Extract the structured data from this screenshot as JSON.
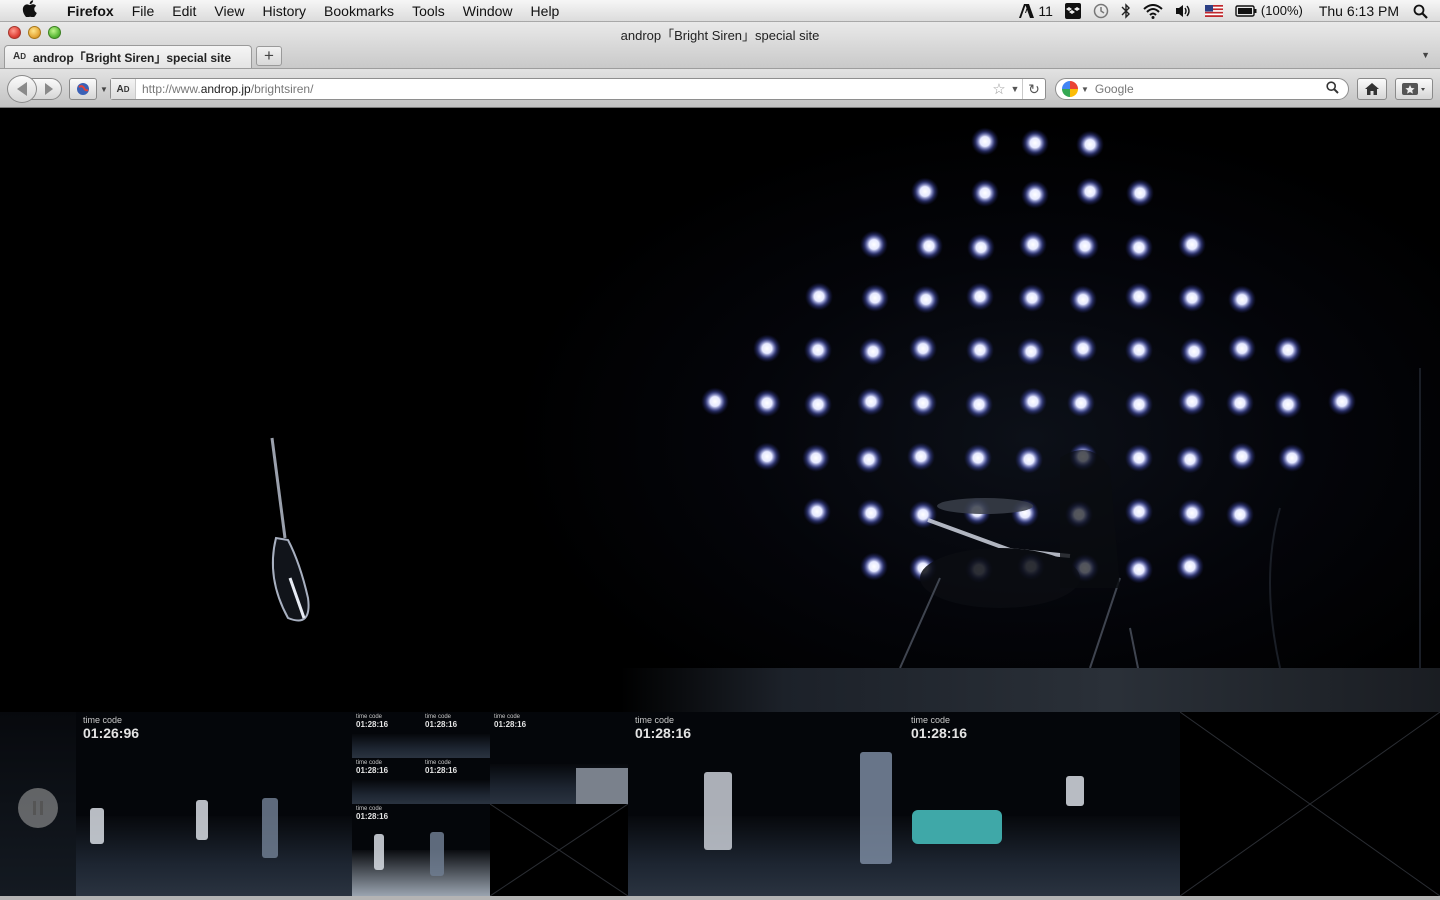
{
  "menubar": {
    "apple": "",
    "items": [
      {
        "label": "Firefox",
        "bold": true
      },
      {
        "label": "File"
      },
      {
        "label": "Edit"
      },
      {
        "label": "View"
      },
      {
        "label": "History"
      },
      {
        "label": "Bookmarks"
      },
      {
        "label": "Tools"
      },
      {
        "label": "Window"
      },
      {
        "label": "Help"
      }
    ],
    "status": {
      "adobe_count": "11",
      "battery": "(100%)",
      "clock": "Thu 6:13 PM"
    }
  },
  "window": {
    "title": "androp「Bright Siren」special site",
    "tab_title": "androp「Bright Siren」special site",
    "new_tab": "+"
  },
  "navbar": {
    "url_prefix": "http://www.",
    "url_host": "androp.jp",
    "url_path": "/brightsiren/",
    "search_placeholder": "Google"
  },
  "thumbnails": [
    {
      "label": "time code",
      "value": "01:26:96"
    },
    {
      "mini": [
        {
          "label": "time code",
          "value": "01:28:16"
        },
        {
          "label": "time code",
          "value": "01:28:16"
        },
        {
          "label": "time code",
          "value": "01:28:16"
        },
        {
          "label": "time code",
          "value": "01:28:16"
        },
        {
          "label": "time code",
          "value": "01:28:16"
        },
        {
          "label": "time code",
          "value": "01:28:16"
        }
      ]
    },
    {
      "label": "time code",
      "value": "01:28:16"
    },
    {
      "label": "time code",
      "value": "01:28:16"
    }
  ],
  "colors": {
    "stage_light": "#ffffff",
    "stage_glow": "#6a78ff"
  }
}
